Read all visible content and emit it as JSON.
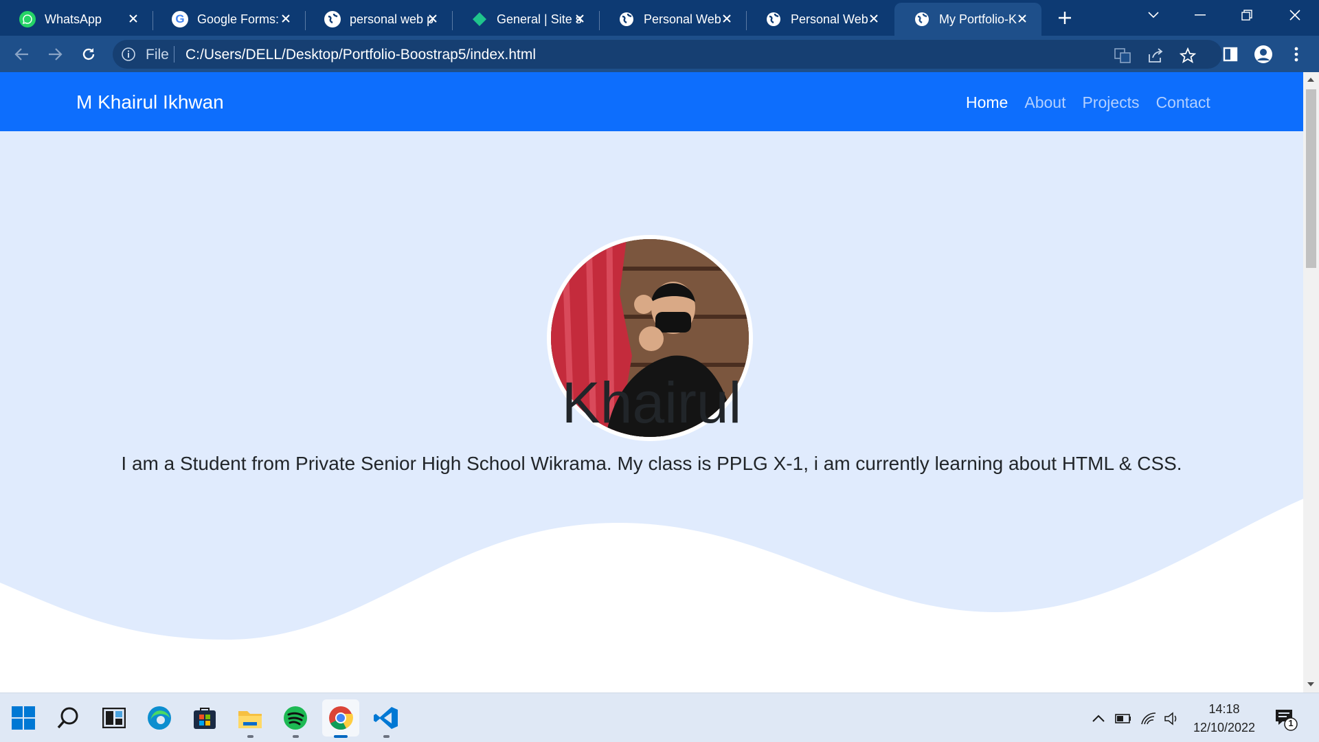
{
  "browser": {
    "tabs": [
      {
        "title": "WhatsApp",
        "icon": "whatsapp-icon",
        "active": false
      },
      {
        "title": "Google Forms:",
        "icon": "google-icon",
        "active": false
      },
      {
        "title": "personal web p",
        "icon": "globe-icon",
        "active": false
      },
      {
        "title": "General | Site s",
        "icon": "diamond-icon",
        "active": false
      },
      {
        "title": "Personal Web",
        "icon": "globe-icon",
        "active": false
      },
      {
        "title": "Personal Web",
        "icon": "globe-icon",
        "active": false
      },
      {
        "title": "My Portfolio-K",
        "icon": "globe-icon",
        "active": true
      }
    ],
    "address": {
      "scheme_label": "File",
      "url": "C:/Users/DELL/Desktop/Portfolio-Boostrap5/index.html"
    }
  },
  "site": {
    "brand": "M Khairul Ikhwan",
    "nav": [
      "Home",
      "About",
      "Projects",
      "Contact"
    ],
    "active_nav": "Home",
    "hero": {
      "name": "Khairul",
      "bio": "I am a Student from Private Senior High School Wikrama. My class is PPLG X-1, i am currently learning about HTML & CSS."
    }
  },
  "taskbar": {
    "apps": [
      "start-icon",
      "search-icon",
      "widgets-icon",
      "edge-icon",
      "store-icon",
      "file-explorer-icon",
      "spotify-icon",
      "chrome-icon",
      "vscode-icon"
    ],
    "clock": {
      "time": "14:18",
      "date": "12/10/2022"
    },
    "notification_count": "1"
  },
  "colors": {
    "tabbar": "#0d3a73",
    "toolbar": "#1e4f8a",
    "navbar": "#0d6efd",
    "hero_bg": "#e0ebfd"
  }
}
